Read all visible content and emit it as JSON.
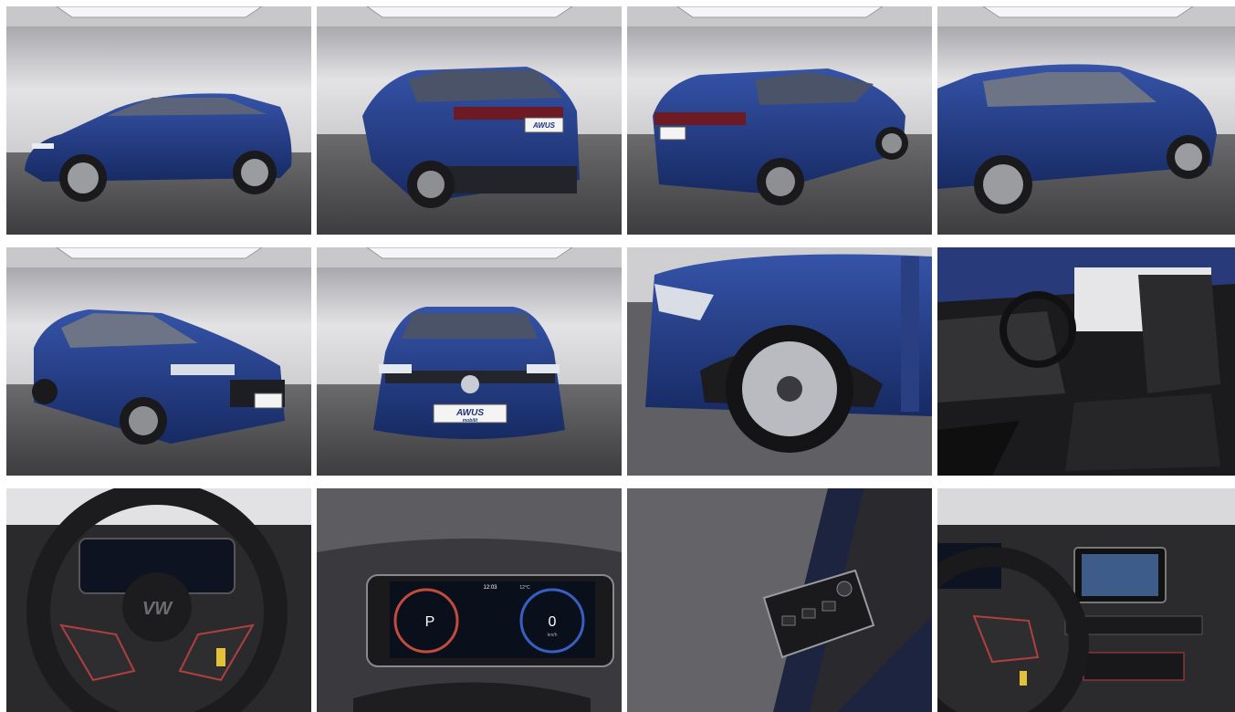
{
  "gallery": {
    "dealer_plate": "AWUS",
    "dealer_plate_sub": "mobilit",
    "cluster": {
      "time": "12:03",
      "temperature": "12°C",
      "gear": "P",
      "speed": "0",
      "speed_unit": "km/h"
    }
  },
  "colors": {
    "car_blue": "#1f3578",
    "showroom_wall": "#d7d7d9",
    "showroom_floor": "#4a4a4c",
    "interior_dark": "#1b1b1d"
  }
}
